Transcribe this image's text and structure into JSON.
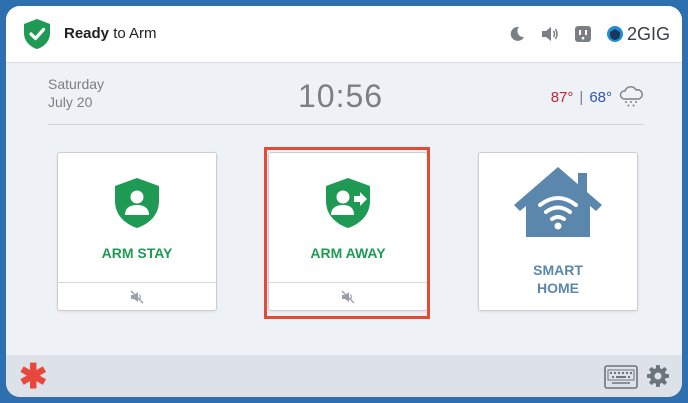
{
  "status": {
    "bold": "Ready",
    "rest": " to Arm"
  },
  "brand": "2GIG",
  "date": {
    "day": "Saturday",
    "monthday": "July 20"
  },
  "clock": "10:56",
  "weather": {
    "high": "87°",
    "sep": "|",
    "low": "68°"
  },
  "cards": [
    {
      "label": "ARM STAY"
    },
    {
      "label": "ARM AWAY"
    },
    {
      "label_line1": "SMART",
      "label_line2": "HOME"
    }
  ],
  "colors": {
    "accent_green": "#1f9a55",
    "smart_blue": "#5b87ad",
    "highlight": "#e34b34",
    "frame": "#2e6fb0"
  },
  "icons": [
    "shield-check-icon",
    "moon-icon",
    "speaker-icon",
    "outlet-icon",
    "brand-logo-icon",
    "snow-cloud-icon",
    "mute-icon",
    "keyboard-icon",
    "gear-icon",
    "asterisk-icon"
  ]
}
